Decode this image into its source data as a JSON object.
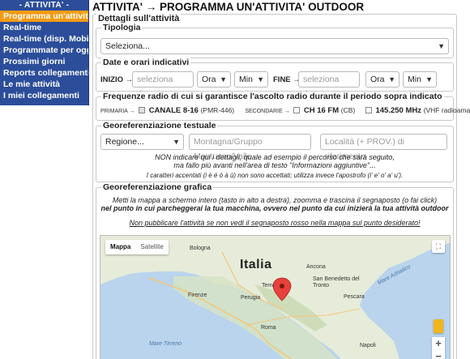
{
  "sidebar": {
    "header": "- ATTIVITA' -",
    "items": [
      {
        "label": "Programma un'attività",
        "active": true
      },
      {
        "label": "Real-time"
      },
      {
        "label": "Real-time (disp. Mobile)"
      },
      {
        "label": "Programmate per oggi"
      },
      {
        "label": "Prossimi giorni"
      },
      {
        "label": "Reports collegamenti"
      },
      {
        "label": "Le mie attività"
      },
      {
        "label": "I miei collegamenti"
      }
    ]
  },
  "page": {
    "title": "ATTIVITA' → PROGRAMMA UN'ATTIVITA' OUTDOOR",
    "details_legend": "Dettagli sull'attività"
  },
  "tipologia": {
    "legend": "Tipologia",
    "value": "Seleziona..."
  },
  "date": {
    "legend": "Date e orari indicativi",
    "inizio_label": "INIZIO →",
    "fine_label": "FINE →",
    "date_placeholder": "seleziona data...",
    "ora": "Ora",
    "min": "Min"
  },
  "freq": {
    "legend": "Frequenze radio di cui si garantisce l'ascolto radio durante il periodo sopra indicato",
    "primaria": "PRIMARIA →",
    "primary_channel": "CANALE 8-16",
    "primary_note": "(PMR-446)",
    "secondarie": "SECONDARIE →",
    "ch16": "CH 16 FM",
    "ch16_note": "(CB)",
    "vhf": "145.250 MHz",
    "vhf_note": "(VHF radioamatoriale)"
  },
  "georef_text": {
    "legend": "Georeferenziazione testuale",
    "regione": "Regione...",
    "montagna_placeholder": "Montagna/Gruppo Montuoso/Valle",
    "localita_placeholder": "Località (+ PROV.) di riferimento",
    "note1": "NON indicare qui i dettagli, quale ad esempio il percorso che sarà seguito,",
    "note2": "ma fallo più avanti nell'area di testo \"Informazioni aggiuntive\"...",
    "note3": "I caratteri accentati (i è é ò à ù) non sono accettati; utilizza invece l'apostrofo (i' e' o' a' u')."
  },
  "georef_map": {
    "legend": "Georeferenziazione grafica",
    "instr1": "Metti la mappa a schermo intero (tasto in alto a destra), zoomma e trascina il segnaposto (o fai click)",
    "instr2": "nel punto in cui parcheggerai la tua macchina, ovvero nel punto da cui inizierà la tua attività outdoor",
    "warning": "Non pubblicare l'attività se non vedi il segnaposto rosso nella mappa sul punto desiderato!",
    "tab_map": "Mappa",
    "tab_sat": "Satellite",
    "country": "Italia",
    "zoom_in": "+",
    "zoom_out": "−",
    "places": [
      "Firenze",
      "Perugia",
      "Ancona",
      "Terni",
      "Roma",
      "Pescara",
      "Napoli",
      "Bologna",
      "San Benedetto del Tronto",
      "Mare Adriatico",
      "Mare Tirreno"
    ]
  }
}
